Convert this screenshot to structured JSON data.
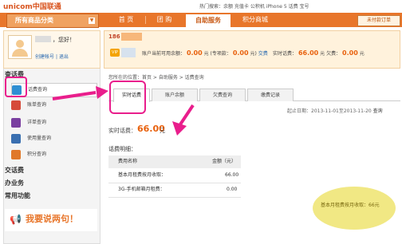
{
  "header": {
    "logo": "unicom中国联通",
    "hot_search": "热门搜索：余额  充值卡  公积机  iPhone 5  话费  宝号"
  },
  "nav": {
    "category_label": "所有商品分类",
    "tabs": [
      "首  页",
      "团  购",
      "自助服务",
      "积分商城"
    ],
    "active_tab": "自助服务",
    "unread_label": "未付款订单"
  },
  "user": {
    "greeting": "，您好！",
    "create_account": "创建帐号",
    "separator": "|",
    "logout": "退出"
  },
  "sidebar": {
    "section_query": "查话费",
    "items": [
      {
        "label": "话费查询",
        "icon": "phone-bill-icon",
        "color": "#2f8fd3"
      },
      {
        "label": "账单查询",
        "icon": "bill-icon",
        "color": "#d64a3a"
      },
      {
        "label": "详单查询",
        "icon": "detail-icon",
        "color": "#7a3fa0"
      },
      {
        "label": "使用量查询",
        "icon": "usage-icon",
        "color": "#3a6fb0"
      },
      {
        "label": "积分查询",
        "icon": "points-icon",
        "color": "#e0782a"
      }
    ],
    "section_pay": "交话费",
    "section_business": "办业务",
    "section_common": "常用功能",
    "promo": "我要说两句！"
  },
  "account": {
    "phone_prefix": "186",
    "vip_badge": "VIP",
    "balance_label": "账户当前可用余额：",
    "balance_value": "0.00",
    "balance_unit": "元",
    "unused_label": "(专项款：",
    "unused_value": "0.00",
    "unused_unit": "元)",
    "recharge_link": "交费",
    "realtime_fee_label": "实时话费：",
    "realtime_fee_value": "66.00",
    "realtime_fee_unit": "元",
    "arrears_label": "欠费：",
    "arrears_value": "0.00",
    "arrears_unit": "元"
  },
  "breadcrumb": "您所在的位置：首页 > 自助服务 > 话费查询",
  "tabs": [
    "实时话费",
    "账户余额",
    "欠费查询",
    "缴费记录"
  ],
  "active_tab": "实时话费",
  "date_range": "起止日期：2013-11-01至2013-11-20",
  "query_label": "查询",
  "realtime": {
    "label": "实时话费：",
    "value": "66.00",
    "unit": "元"
  },
  "detail": {
    "title": "话费明细：",
    "columns": [
      "费用名称",
      "金额（元）"
    ],
    "rows": [
      [
        "基本月租费按月收取：",
        "66.00"
      ],
      [
        "3G-手机邮箱月租费：",
        "0.00"
      ]
    ]
  },
  "watermark": "基本月租费按月收取：66元",
  "colors": {
    "nav": "#e8762b",
    "accent": "#e8620f",
    "highlight": "#e91e8c"
  }
}
